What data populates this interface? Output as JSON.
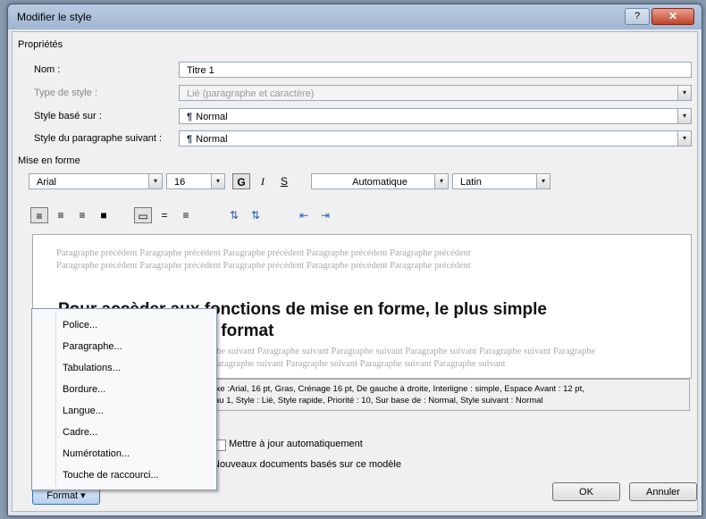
{
  "window": {
    "title": "Modifier le style",
    "help": "?",
    "close": "✕"
  },
  "proprietes": {
    "label": "Propriétés",
    "nom": {
      "label": "Nom :",
      "value": "Titre 1"
    },
    "type": {
      "label": "Type de style :",
      "value": "Lié (paragraphe et caractère)"
    },
    "base": {
      "label": "Style basé sur :",
      "value": "Normal"
    },
    "suivant": {
      "label": "Style du paragraphe suivant :",
      "value": "Normal"
    }
  },
  "mise_en_forme": {
    "label": "Mise en forme",
    "font": "Arial",
    "size": "16",
    "bold": "G",
    "italic": "I",
    "underline": "S",
    "color": "Automatique",
    "script": "Latin"
  },
  "preview": {
    "prev1": "Paragraphe précédent Paragraphe précédent Paragraphe précédent Paragraphe précédent Paragraphe précédent",
    "prev2": "Paragraphe précédent Paragraphe précédent Paragraphe précédent Paragraphe précédent Paragraphe précédent",
    "heading1": "Pour accèder aux fonctions de mise en forme, le plus simple",
    "heading2": "ur format",
    "next1": "phe suivant Paragraphe suivant Paragraphe suivant Paragraphe suivant Paragraphe suivant Paragraphe",
    "next2": "Paragraphe suivant Paragraphe suivant Paragraphe suivant Paragraphe suivant"
  },
  "description": {
    "line1": "mplexe :Arial, 16 pt, Gras, Crénage 16 pt, De gauche à droite, Interligne : simple, Espace Avant : 12 pt,",
    "line2": "Niveau 1, Style : Lié, Style rapide, Priorité : 10, Sur base de : Normal, Style suivant : Normal"
  },
  "options": {
    "update": "Mettre à jour automatiquement",
    "new_docs": "Nouveaux documents basés sur ce modèle"
  },
  "menu": {
    "items": [
      "Police...",
      "Paragraphe...",
      "Tabulations...",
      "Bordure...",
      "Langue...",
      "Cadre...",
      "Numérotation...",
      "Touche de raccourci..."
    ]
  },
  "buttons": {
    "format": "Format ▾",
    "ok": "OK",
    "annuler": "Annuler"
  }
}
